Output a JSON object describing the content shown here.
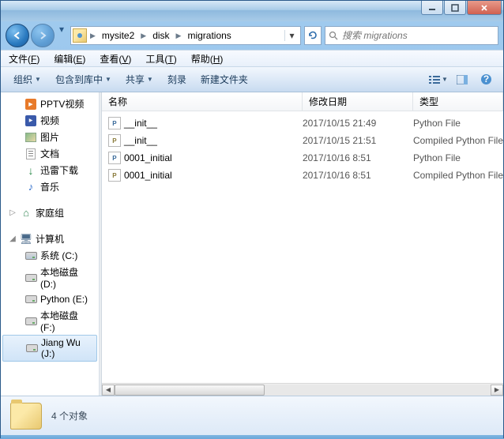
{
  "window": {
    "min_tip": "最小化",
    "max_tip": "最大化",
    "close_tip": "关闭"
  },
  "address": {
    "crumbs": [
      "mysite2",
      "disk",
      "migrations"
    ]
  },
  "search": {
    "placeholder": "搜索 migrations"
  },
  "menubar": {
    "items": [
      {
        "label": "文件",
        "key": "F"
      },
      {
        "label": "编辑",
        "key": "E"
      },
      {
        "label": "查看",
        "key": "V"
      },
      {
        "label": "工具",
        "key": "T"
      },
      {
        "label": "帮助",
        "key": "H"
      }
    ]
  },
  "toolbar": {
    "organize": "组织",
    "include": "包含到库中",
    "share": "共享",
    "burn": "刻录",
    "newfolder": "新建文件夹"
  },
  "sidebar": {
    "items": [
      {
        "type": "item",
        "lvl": 2,
        "icon": "pptv",
        "label": "PPTV视频"
      },
      {
        "type": "item",
        "lvl": 2,
        "icon": "video",
        "label": "视频"
      },
      {
        "type": "item",
        "lvl": 2,
        "icon": "pic",
        "label": "图片"
      },
      {
        "type": "item",
        "lvl": 2,
        "icon": "doc",
        "label": "文档"
      },
      {
        "type": "item",
        "lvl": 2,
        "icon": "dl",
        "label": "迅雷下载"
      },
      {
        "type": "item",
        "lvl": 2,
        "icon": "music",
        "label": "音乐"
      },
      {
        "type": "sep"
      },
      {
        "type": "group",
        "icon": "home",
        "label": "家庭组",
        "tree": "▷"
      },
      {
        "type": "sep"
      },
      {
        "type": "group",
        "icon": "comp",
        "label": "计算机",
        "tree": "◢"
      },
      {
        "type": "item",
        "lvl": 2,
        "icon": "drive-sys",
        "label": "系统 (C:)"
      },
      {
        "type": "item",
        "lvl": 2,
        "icon": "drive",
        "label": "本地磁盘 (D:)"
      },
      {
        "type": "item",
        "lvl": 2,
        "icon": "drive",
        "label": "Python (E:)"
      },
      {
        "type": "item",
        "lvl": 2,
        "icon": "drive",
        "label": "本地磁盘 (F:)"
      },
      {
        "type": "item",
        "lvl": 2,
        "icon": "drive",
        "label": "Jiang Wu (J:)",
        "selected": true
      },
      {
        "type": "sep"
      }
    ]
  },
  "columns": {
    "name": "名称",
    "date": "修改日期",
    "type": "类型"
  },
  "files": [
    {
      "icon": "py",
      "name": "__init__",
      "date": "2017/10/15 21:49",
      "type": "Python File"
    },
    {
      "icon": "pyc",
      "name": "__init__",
      "date": "2017/10/15 21:51",
      "type": "Compiled Python File"
    },
    {
      "icon": "py",
      "name": "0001_initial",
      "date": "2017/10/16 8:51",
      "type": "Python File"
    },
    {
      "icon": "pyc",
      "name": "0001_initial",
      "date": "2017/10/16 8:51",
      "type": "Compiled Python File"
    }
  ],
  "status": {
    "count_label": "4 个对象"
  }
}
